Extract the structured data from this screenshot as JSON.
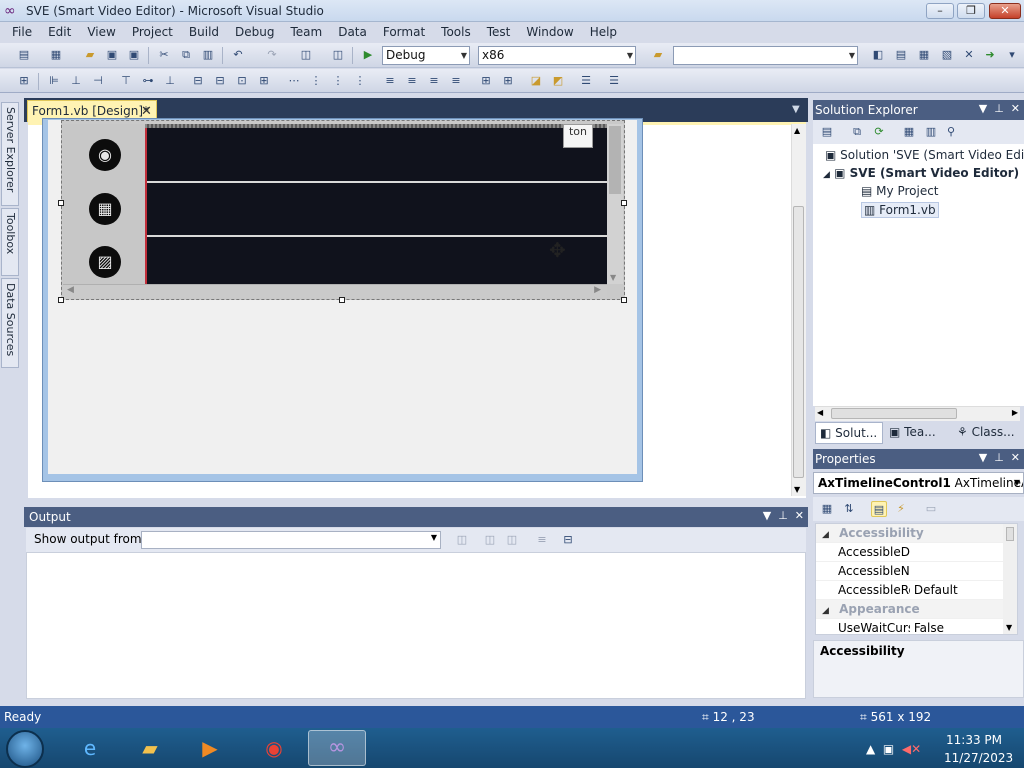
{
  "window": {
    "title": "SVE (Smart Video Editor) - Microsoft Visual Studio",
    "app_icon": "vs-infinity-icon"
  },
  "window_controls": {
    "minimize": "–",
    "restore": "❐",
    "close": "✕"
  },
  "menu": [
    "File",
    "Edit",
    "View",
    "Project",
    "Build",
    "Debug",
    "Team",
    "Data",
    "Format",
    "Tools",
    "Test",
    "Window",
    "Help"
  ],
  "toolbar": {
    "configuration": "Debug",
    "platform": "x86",
    "find_value": ""
  },
  "side_tabs": [
    "Server Explorer",
    "Toolbox",
    "Data Sources"
  ],
  "document": {
    "tab_label": "Form1.vb [Design]*",
    "close_glyph": "✕"
  },
  "control": {
    "button_text": "ton",
    "icons": [
      "globe-icon",
      "film-icon",
      "add-image-icon"
    ]
  },
  "output": {
    "title": "Output",
    "show_from_label": "Show output from:",
    "show_from_value": "",
    "text": ""
  },
  "solution_explorer": {
    "title": "Solution Explorer",
    "items": [
      {
        "label": "Solution 'SVE (Smart Video Editor)",
        "bold": false
      },
      {
        "label": "SVE (Smart Video Editor)",
        "bold": true
      },
      {
        "label": "My Project",
        "bold": false
      },
      {
        "label": "Form1.vb",
        "bold": false
      }
    ],
    "tabs": [
      "Solut...",
      "Tea...",
      "Class..."
    ]
  },
  "properties": {
    "title": "Properties",
    "object_name": "AxTimelineControl1",
    "object_type": "AxTimelineA",
    "rows": [
      {
        "type": "category",
        "name": "Accessibility",
        "value": ""
      },
      {
        "type": "prop",
        "name": "AccessibleDes",
        "value": ""
      },
      {
        "type": "prop",
        "name": "AccessibleNar",
        "value": ""
      },
      {
        "type": "prop",
        "name": "AccessibleRol",
        "value": "Default"
      },
      {
        "type": "category",
        "name": "Appearance",
        "value": ""
      },
      {
        "type": "prop",
        "name": "UseWaitCursc",
        "value": "False"
      }
    ],
    "description_title": "Accessibility"
  },
  "status": {
    "ready": "Ready",
    "position": "12 , 23",
    "size": "561 x 192"
  },
  "taskbar": {
    "time": "11:33 PM",
    "date": "11/27/2023",
    "apps": [
      "internet-explorer-icon",
      "file-explorer-icon",
      "media-player-icon",
      "chrome-icon",
      "visual-studio-icon"
    ]
  }
}
